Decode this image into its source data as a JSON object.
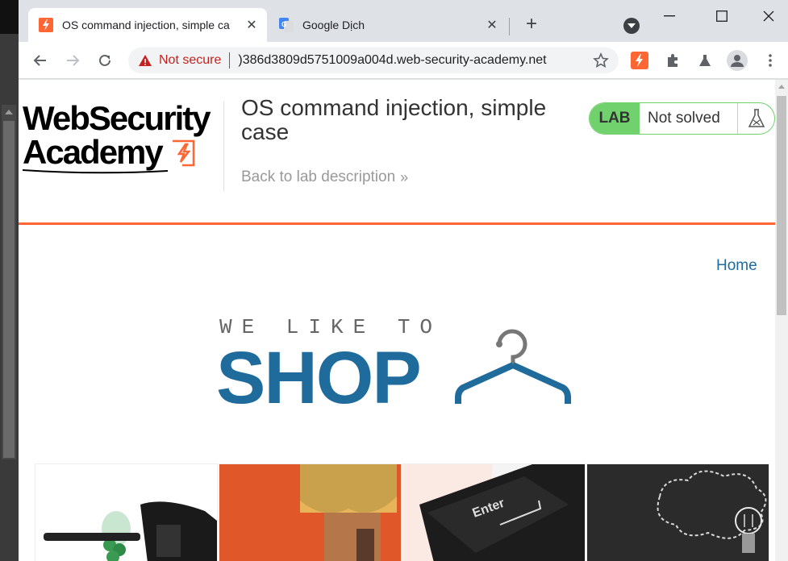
{
  "browser": {
    "tabs": [
      {
        "title": "OS command injection, simple ca",
        "active": true,
        "icon": "portswigger-lightning-icon"
      },
      {
        "title": "Google Dịch",
        "active": false,
        "icon": "google-translate-icon"
      }
    ],
    "new_tab_symbol": "+",
    "omnibox": {
      "security_label": "Not secure",
      "url": ")386d3809d5751009a004d.web-security-academy.net"
    }
  },
  "academy": {
    "logo_line1": "WebSecurity",
    "logo_line2": "Academy",
    "lab_title": "OS command injection, simple case",
    "back_link": "Back to lab description",
    "back_chevron": "»",
    "lab_badge": "LAB",
    "lab_status": "Not solved",
    "accent_color": "#ff6633",
    "status_color": "#70d16d"
  },
  "shop": {
    "nav_home": "Home",
    "tagline": "WE LIKE TO",
    "title": "SHOP",
    "brand_color": "#1f6b9b"
  },
  "products": [
    {
      "name": "paintball-gun-image"
    },
    {
      "name": "toy-figure-image"
    },
    {
      "name": "enter-key-image"
    },
    {
      "name": "lightbulb-chalkboard-image"
    }
  ]
}
